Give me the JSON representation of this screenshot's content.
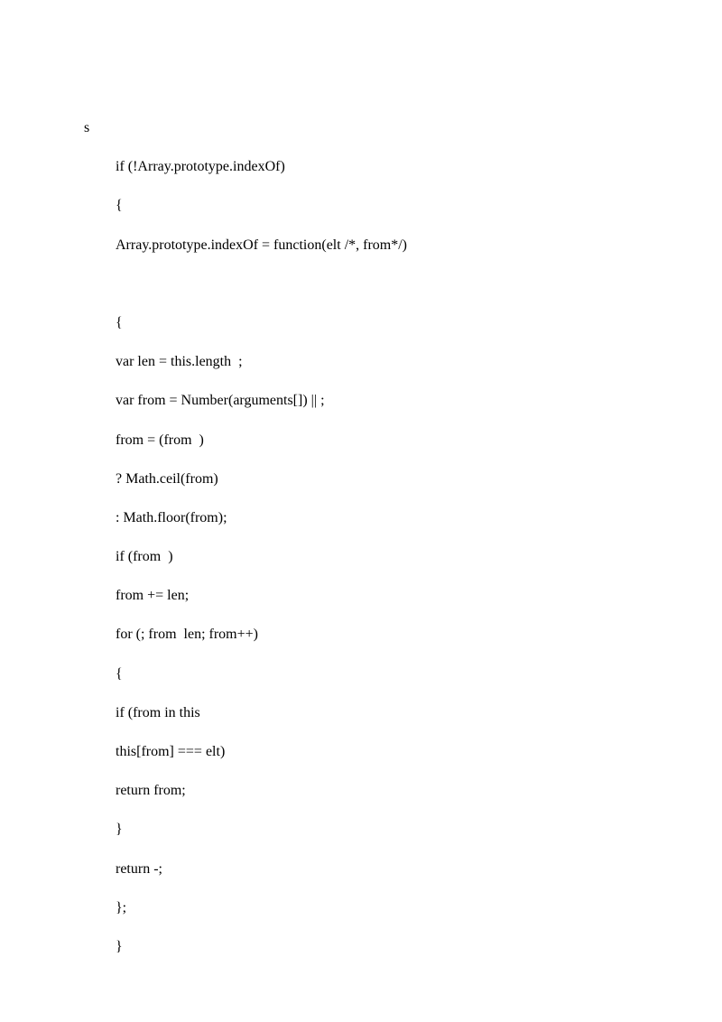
{
  "lines": [
    "s",
    "if (!Array.prototype.indexOf)",
    "{",
    "Array.prototype.indexOf = function(elt /*, from*/)",
    "",
    "{",
    "var len = this.length  ;",
    "var from = Number(arguments[]) || ;",
    "from = (from  )",
    "? Math.ceil(from)",
    ": Math.floor(from);",
    "if (from  )",
    "from += len;",
    "for (; from  len; from++)",
    "{",
    "if (from in this",
    "this[from] === elt)",
    "return from;",
    "}",
    "return -;",
    "};",
    "}"
  ]
}
